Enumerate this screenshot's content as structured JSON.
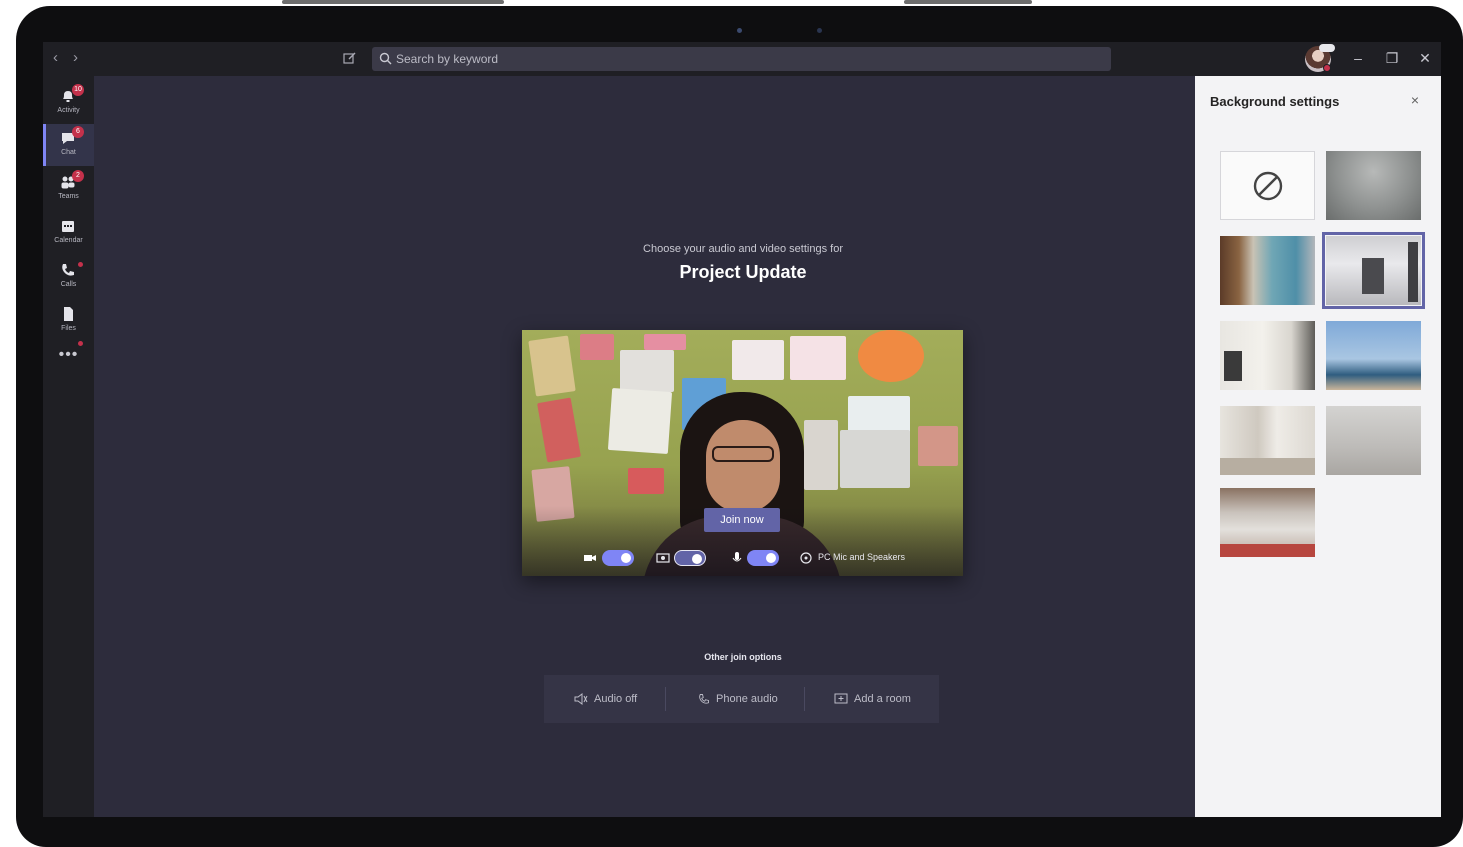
{
  "search": {
    "placeholder": "Search by keyword"
  },
  "appbar": {
    "items": [
      {
        "label": "Activity",
        "badge": "10"
      },
      {
        "label": "Chat",
        "badge": "6"
      },
      {
        "label": "Teams",
        "badge": "2"
      },
      {
        "label": "Calendar",
        "badge": ""
      },
      {
        "label": "Calls",
        "badge": ""
      },
      {
        "label": "Files",
        "badge": ""
      }
    ],
    "more": "•••"
  },
  "prejoin": {
    "subtitle": "Choose your audio and video settings for",
    "meeting_title": "Project Update",
    "join_label": "Join now",
    "device_label": "PC Mic and Speakers"
  },
  "other_options": {
    "title": "Other join options",
    "items": [
      "Audio off",
      "Phone audio",
      "Add a room"
    ]
  },
  "bg_panel": {
    "title": "Background settings",
    "close": "×"
  },
  "colors": {
    "accent": "#6264a7",
    "toggle": "#7f85f5",
    "app_bg": "#2d2c3c",
    "chrome": "#1f1f24",
    "badge": "#c4314b"
  }
}
